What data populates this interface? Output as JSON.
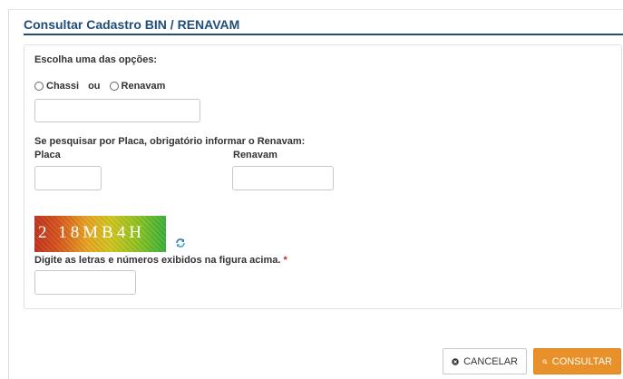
{
  "page": {
    "title": "Consultar Cadastro BIN / RENAVAM"
  },
  "form": {
    "choose_label": "Escolha uma das opções:",
    "radio_chassi": "Chassi",
    "radio_sep": "ou",
    "radio_renavam": "Renavam",
    "main_input_value": "",
    "placa_note": "Se pesquisar por Placa, obrigatório informar o Renavam:",
    "placa_label": "Placa",
    "placa_value": "",
    "renavam_label": "Renavam",
    "renavam_value": "",
    "captcha_text": "2 18MB4H",
    "captcha_instruction": "Digite as letras e números exibidos na figura acima.",
    "required_mark": "*",
    "captcha_value": ""
  },
  "actions": {
    "cancel_label": "CANCELAR",
    "search_label": "CONSULTAR"
  },
  "colors": {
    "title": "#1f4e79",
    "search_button": "#e8902a",
    "required": "#c62828"
  },
  "icons": {
    "cancel": "close-circle-icon",
    "search": "search-icon",
    "refresh": "refresh-icon"
  }
}
